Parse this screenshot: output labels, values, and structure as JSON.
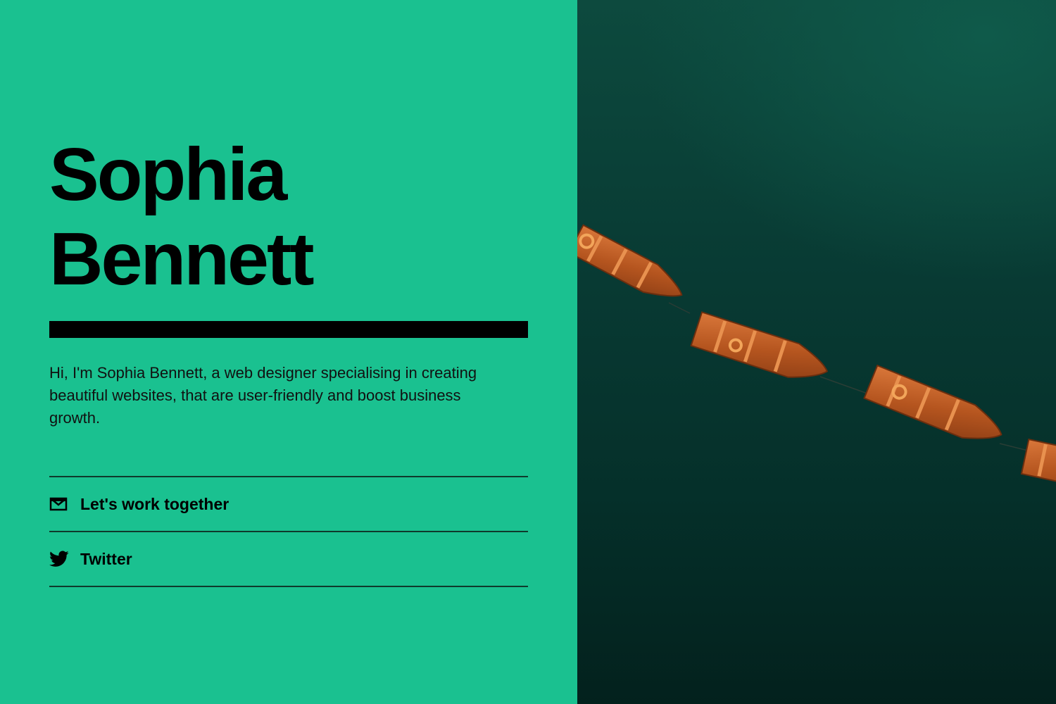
{
  "profile": {
    "first_name": "Sophia",
    "last_name": "Bennett",
    "bio": "Hi, I'm Sophia Bennett, a web designer specialising in creating beautiful websites, that are user-friendly and boost business growth."
  },
  "links": [
    {
      "label": "Let's work together",
      "icon": "mail-icon"
    },
    {
      "label": "Twitter",
      "icon": "twitter-icon"
    }
  ],
  "colors": {
    "accent": "#1ac190",
    "text": "#000000",
    "water": "#083a33",
    "boat": "#c8652a"
  },
  "hero_image": {
    "icon": "rowboats-on-water-photo"
  }
}
